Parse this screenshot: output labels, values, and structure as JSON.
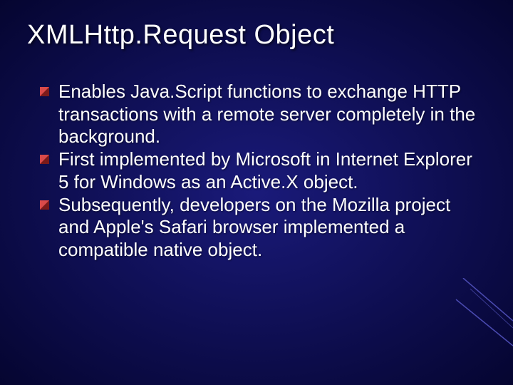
{
  "title": "XMLHttp.Request Object",
  "bullets": [
    "Enables Java.Script functions to exchange HTTP transactions with a remote server completely in the background.",
    "First implemented by Microsoft in Internet Explorer 5 for Windows as an Active.X object.",
    "Subsequently, developers on the Mozilla project and Apple's Safari browser implemented a compatible native object."
  ],
  "colors": {
    "bullet_light": "#d94a4a",
    "bullet_dark": "#7a1a1a"
  }
}
